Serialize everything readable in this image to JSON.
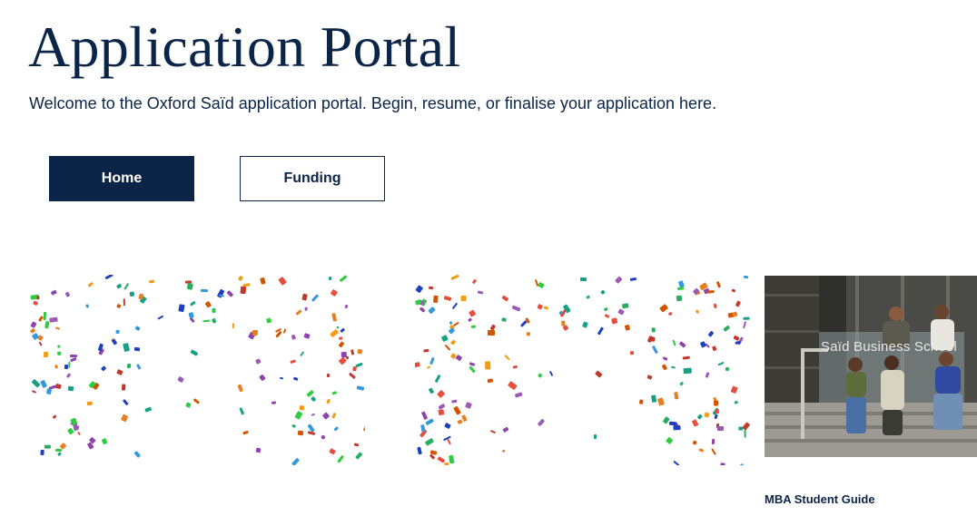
{
  "header": {
    "title": "Application Portal",
    "welcome_text": "Welcome to the Oxford Saïd application portal. Begin, resume, or finalise your application here."
  },
  "nav": {
    "home_label": "Home",
    "funding_label": "Funding",
    "active": "Home"
  },
  "cards": {
    "mba_guide": {
      "caption": "MBA Student Guide",
      "image_sign_text": "Saïd Business School"
    }
  },
  "colors": {
    "brand_navy": "#0b2548",
    "background": "#ffffff",
    "confetti": [
      "#1f3fbf",
      "#c0392b",
      "#e67e22",
      "#27ae60",
      "#9b59b6",
      "#16a085",
      "#d35400",
      "#2ecc40",
      "#8e44ad",
      "#e74c3c",
      "#3498db",
      "#f39c12"
    ]
  }
}
